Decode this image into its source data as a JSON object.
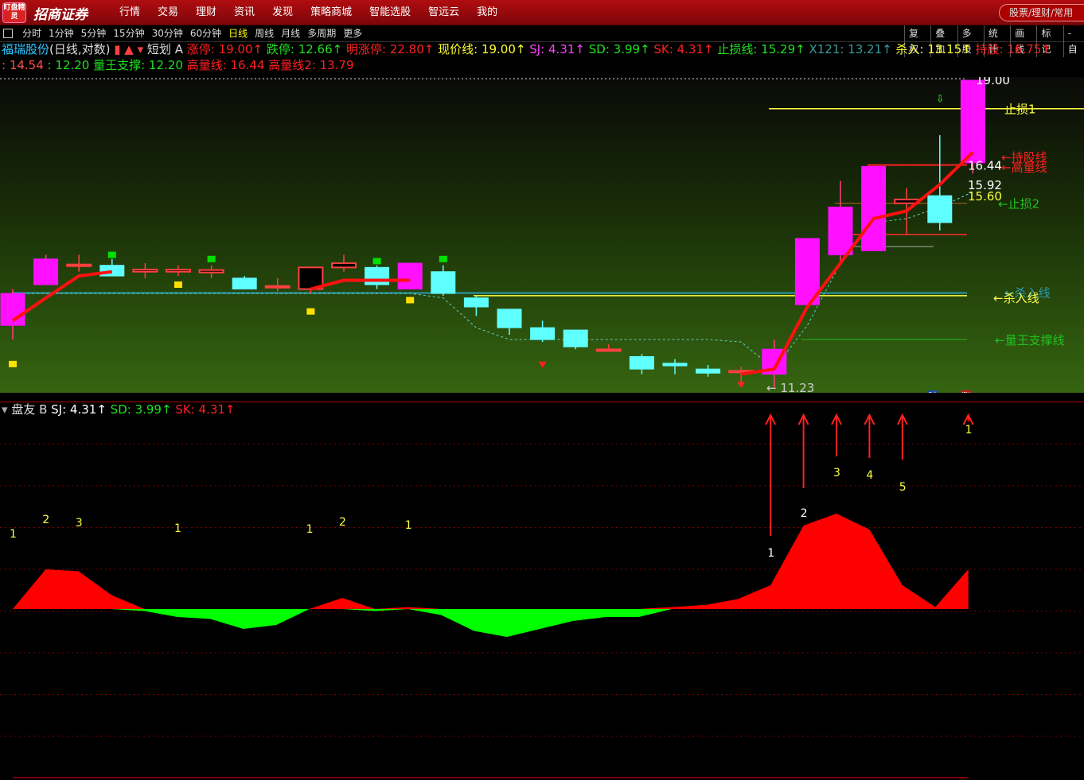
{
  "topbar": {
    "logo_text": "盯盘精灵",
    "brand": "招商证券",
    "menu": [
      "行情",
      "交易",
      "理财",
      "资讯",
      "发现",
      "策略商城",
      "智能选股",
      "智远云",
      "我的"
    ],
    "search_placeholder": "股票/理财/常用"
  },
  "periodbar": {
    "periods": [
      "分时",
      "1分钟",
      "5分钟",
      "15分钟",
      "30分钟",
      "60分钟",
      "日线",
      "周线",
      "月线",
      "多周期",
      "更多"
    ],
    "active": "日线",
    "tools": [
      "复权",
      "叠加",
      "多股",
      "统计",
      "画线",
      "标记",
      "-自"
    ]
  },
  "info_line1": {
    "stock": "福瑞股份",
    "mode": "(日线,对数)",
    "indicator": "短划",
    "flag": "A",
    "items": [
      {
        "label": "涨停:",
        "value": "19.00",
        "color": "#ff2020"
      },
      {
        "label": "跌停:",
        "value": "12.66",
        "color": "#20e020"
      },
      {
        "label": "明涨停:",
        "value": "22.80",
        "color": "#ff2020"
      },
      {
        "label": "现价线:",
        "value": "19.00",
        "color": "#ffff30"
      },
      {
        "label": "SJ:",
        "value": "4.31",
        "color": "#ff40ff"
      },
      {
        "label": "SD:",
        "value": "3.99",
        "color": "#20e020"
      },
      {
        "label": "SK:",
        "value": "4.31",
        "color": "#ff2020"
      },
      {
        "label": "止损线:",
        "value": "15.29",
        "color": "#20e020"
      },
      {
        "label": "X121:",
        "value": "13.21",
        "color": "#3a9a9a"
      },
      {
        "label": "杀入:",
        "value": "13.15",
        "color": "#ffff30"
      },
      {
        "label": "持股:",
        "value": "16.75",
        "color": "#ff2020"
      }
    ]
  },
  "info_line2": {
    "items": [
      {
        "label": ":",
        "value": "14.54",
        "color": "#ff5050"
      },
      {
        "label": ":",
        "value": "12.20",
        "color": "#20e020"
      },
      {
        "label": "量王支撑:",
        "value": "12.20",
        "color": "#20e020"
      },
      {
        "label": "高量线:",
        "value": "16.44",
        "color": "#ff2020"
      },
      {
        "label": "高量线2:",
        "value": "13.79",
        "color": "#ff2020"
      }
    ]
  },
  "price_labels": {
    "top": "19.00",
    "high_vol": "16.44",
    "p1": "15.92",
    "p2": "15.60",
    "low": "11.23"
  },
  "chart_annotations": {
    "stop1": "止损1",
    "hold_line": "←持股线",
    "high_vol_line": "←高量线",
    "stop2": "←止损2",
    "kill_line": "←杀入线",
    "kill_line_ghost": "←杀入线",
    "support_line": "←量王支撑线",
    "badge_cai": "财",
    "badge_zhang": "涨"
  },
  "sub_info": {
    "name": "盘友",
    "flag": "B",
    "items": [
      {
        "label": "SJ:",
        "value": "4.31",
        "color": "#ffffff"
      },
      {
        "label": "SD:",
        "value": "3.99",
        "color": "#20e020"
      },
      {
        "label": "SK:",
        "value": "4.31",
        "color": "#ff2020"
      }
    ]
  },
  "sub_numbers": [
    "1",
    "2",
    "3",
    "1",
    "1",
    "2",
    "1",
    "1",
    "2",
    "3",
    "4",
    "5",
    "1"
  ],
  "chart_data": {
    "type": "candlestick",
    "price_axis": "log",
    "candles": [
      {
        "o": 12.5,
        "h": 13.3,
        "l": 12.2,
        "c": 13.2
      },
      {
        "o": 13.4,
        "h": 14.1,
        "l": 13.4,
        "c": 14.0
      },
      {
        "o": 13.85,
        "h": 14.1,
        "l": 13.7,
        "c": 13.85
      },
      {
        "o": 13.85,
        "h": 14.0,
        "l": 13.65,
        "c": 13.6
      },
      {
        "o": 13.7,
        "h": 13.9,
        "l": 13.55,
        "c": 13.75
      },
      {
        "o": 13.7,
        "h": 13.85,
        "l": 13.6,
        "c": 13.75
      },
      {
        "o": 13.7,
        "h": 13.85,
        "l": 13.55,
        "c": 13.72
      },
      {
        "o": 13.55,
        "h": 13.6,
        "l": 13.3,
        "c": 13.3
      },
      {
        "o": 13.35,
        "h": 13.55,
        "l": 13.25,
        "c": 13.35
      },
      {
        "o": 13.3,
        "h": 13.8,
        "l": 13.2,
        "c": 13.8
      },
      {
        "o": 13.8,
        "h": 14.1,
        "l": 13.7,
        "c": 13.9
      },
      {
        "o": 13.8,
        "h": 13.85,
        "l": 13.3,
        "c": 13.4
      },
      {
        "o": 13.3,
        "h": 13.9,
        "l": 13.3,
        "c": 13.9
      },
      {
        "o": 13.7,
        "h": 13.85,
        "l": 13.15,
        "c": 13.2
      },
      {
        "o": 13.1,
        "h": 13.15,
        "l": 12.7,
        "c": 12.9
      },
      {
        "o": 12.85,
        "h": 12.85,
        "l": 12.3,
        "c": 12.45
      },
      {
        "o": 12.45,
        "h": 12.6,
        "l": 12.15,
        "c": 12.2
      },
      {
        "o": 12.4,
        "h": 12.4,
        "l": 12.0,
        "c": 12.05
      },
      {
        "o": 11.98,
        "h": 12.1,
        "l": 11.95,
        "c": 11.98
      },
      {
        "o": 11.85,
        "h": 11.9,
        "l": 11.5,
        "c": 11.6
      },
      {
        "o": 11.7,
        "h": 11.8,
        "l": 11.5,
        "c": 11.68
      },
      {
        "o": 11.6,
        "h": 11.68,
        "l": 11.45,
        "c": 11.52
      },
      {
        "o": 11.55,
        "h": 11.65,
        "l": 11.3,
        "c": 11.55
      },
      {
        "o": 11.5,
        "h": 12.2,
        "l": 11.23,
        "c": 12.0
      },
      {
        "o": 12.95,
        "h": 14.5,
        "l": 12.9,
        "c": 14.5
      },
      {
        "o": 14.1,
        "h": 16.0,
        "l": 13.9,
        "c": 15.3
      },
      {
        "o": 14.2,
        "h": 16.4,
        "l": 14.2,
        "c": 16.4
      },
      {
        "o": 15.4,
        "h": 15.8,
        "l": 14.6,
        "c": 15.5
      },
      {
        "o": 15.6,
        "h": 17.3,
        "l": 14.7,
        "c": 14.9
      },
      {
        "o": 16.5,
        "h": 19.0,
        "l": 16.2,
        "c": 19.0
      }
    ],
    "hold_line": [
      12.6,
      13.1,
      13.6,
      13.7,
      null,
      null,
      null,
      null,
      null,
      13.3,
      13.5,
      13.5,
      13.5,
      null,
      null,
      null,
      null,
      null,
      null,
      null,
      null,
      null,
      11.5,
      11.6,
      12.9,
      13.9,
      15.0,
      15.2,
      15.9,
      16.8
    ],
    "indicator": {
      "type": "area",
      "values": [
        0,
        1.0,
        0.95,
        0.35,
        -0.05,
        -0.2,
        -0.25,
        -0.5,
        -0.4,
        0,
        0.28,
        -0.05,
        0.05,
        -0.15,
        -0.55,
        -0.7,
        -0.5,
        -0.3,
        -0.2,
        -0.2,
        0.05,
        0.1,
        0.25,
        0.6,
        2.1,
        2.4,
        2.0,
        0.6,
        0.05,
        1.0
      ]
    }
  }
}
